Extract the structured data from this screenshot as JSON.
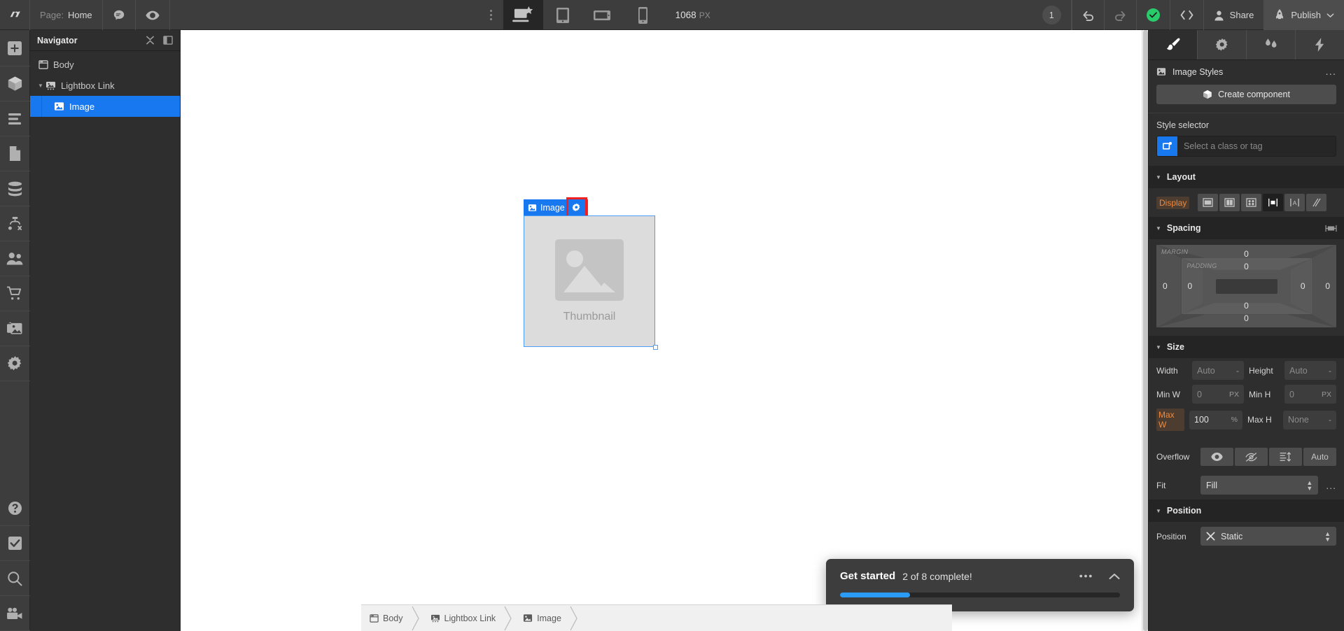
{
  "topbar": {
    "logo_icon": "webflow-logo-icon",
    "page_prefix": "Page:",
    "page_name": "Home",
    "comment_icon": "comment-icon",
    "preview_icon": "eye-icon",
    "more_icon": "vertical-dots-icon",
    "devices": [
      {
        "name": "desktop",
        "icon": "desktop-star-icon",
        "active": true
      },
      {
        "name": "tablet",
        "icon": "tablet-icon",
        "active": false
      },
      {
        "name": "tablet-landscape",
        "icon": "tablet-landscape-icon",
        "active": false
      },
      {
        "name": "mobile",
        "icon": "mobile-icon",
        "active": false
      }
    ],
    "viewport_value": "1068",
    "viewport_unit": "PX",
    "notification_count": "1",
    "undo_icon": "undo-icon",
    "redo_icon": "redo-icon",
    "status_icon": "check-circle-icon",
    "code_icon": "code-brackets-icon",
    "share_label": "Share",
    "share_icon": "person-icon",
    "publish_label": "Publish",
    "publish_icon": "rocket-icon",
    "publish_caret": "chevron-down-icon"
  },
  "lefttools": {
    "items": [
      {
        "name": "add-elements",
        "icon": "plus-icon"
      },
      {
        "name": "components",
        "icon": "cube-icon"
      },
      {
        "name": "navigator",
        "icon": "layers-icon"
      },
      {
        "name": "pages",
        "icon": "page-icon"
      },
      {
        "name": "cms",
        "icon": "database-icon"
      },
      {
        "name": "logic",
        "icon": "logic-flow-icon"
      },
      {
        "name": "users",
        "icon": "users-icon"
      },
      {
        "name": "ecommerce",
        "icon": "cart-icon"
      },
      {
        "name": "assets",
        "icon": "assets-images-icon"
      },
      {
        "name": "settings",
        "icon": "gear-icon"
      }
    ],
    "bottom_items": [
      {
        "name": "help",
        "icon": "question-circle-icon"
      },
      {
        "name": "audit",
        "icon": "checkmark-icon"
      },
      {
        "name": "search",
        "icon": "magnifier-icon"
      },
      {
        "name": "video",
        "icon": "video-camera-icon"
      }
    ]
  },
  "navigator": {
    "title": "Navigator",
    "collapse_icon": "collapse-icon",
    "dock_icon": "panel-dock-icon",
    "tree": [
      {
        "label": "Body",
        "icon": "body-icon",
        "depth": 0,
        "selected": false,
        "caret": ""
      },
      {
        "label": "Lightbox Link",
        "icon": "lightbox-icon",
        "depth": 0,
        "selected": false,
        "caret": "▼"
      },
      {
        "label": "Image",
        "icon": "image-icon",
        "depth": 1,
        "selected": true,
        "caret": ""
      }
    ]
  },
  "canvas": {
    "selected_label": "Image",
    "selected_icon": "image-icon",
    "settings_icon": "gear-icon",
    "placeholder_text": "Thumbnail",
    "placeholder_icon": "image-placeholder-icon"
  },
  "toast": {
    "title": "Get started",
    "subtitle": "2 of 8 complete!",
    "more_icon": "horizontal-dots-icon",
    "collapse_icon": "chevron-up-icon",
    "progress_percent": 25
  },
  "breadcrumb": {
    "items": [
      {
        "label": "Body",
        "icon": "body-icon"
      },
      {
        "label": "Lightbox Link",
        "icon": "lightbox-icon"
      },
      {
        "label": "Image",
        "icon": "image-icon"
      }
    ]
  },
  "rightpanel": {
    "tabs": [
      {
        "name": "style",
        "icon": "paintbrush-icon",
        "active": true
      },
      {
        "name": "settings",
        "icon": "gear-icon",
        "active": false
      },
      {
        "name": "interactions",
        "icon": "droplets-icon",
        "active": false
      },
      {
        "name": "effects",
        "icon": "lightning-icon",
        "active": false
      }
    ],
    "styles_title": "Image Styles",
    "styles_icon": "image-icon",
    "styles_more": "...",
    "create_component_label": "Create component",
    "create_component_icon": "cube-icon",
    "style_selector_label": "Style selector",
    "style_selector_placeholder": "Select a class or tag",
    "style_selector_icon": "tag-icon",
    "layout": {
      "title": "Layout",
      "display_label": "Display",
      "options": [
        {
          "name": "display-block",
          "icon": "block-icon",
          "active": false
        },
        {
          "name": "display-flex",
          "icon": "flex-icon",
          "active": false
        },
        {
          "name": "display-grid",
          "icon": "grid-icon",
          "active": false
        },
        {
          "name": "display-inline-block",
          "icon": "inline-block-icon",
          "active": true
        },
        {
          "name": "display-inline",
          "icon": "inline-icon",
          "active": false
        },
        {
          "name": "display-none",
          "icon": "none-icon",
          "active": false
        }
      ]
    },
    "spacing": {
      "title": "Spacing",
      "link_icon": "spacing-link-icon",
      "margin_label": "MARGIN",
      "padding_label": "PADDING",
      "margin_top": "0",
      "margin_right": "0",
      "margin_bottom": "0",
      "margin_left": "0",
      "padding_top": "0",
      "padding_right": "0",
      "padding_bottom": "0",
      "padding_left": "0"
    },
    "size": {
      "title": "Size",
      "fields": [
        {
          "label": "Width",
          "value": "Auto",
          "unit": "-",
          "dim": true,
          "hot": false
        },
        {
          "label": "Height",
          "value": "Auto",
          "unit": "-",
          "dim": true,
          "hot": false
        },
        {
          "label": "Min W",
          "value": "0",
          "unit": "PX",
          "dim": true,
          "hot": false
        },
        {
          "label": "Min H",
          "value": "0",
          "unit": "PX",
          "dim": true,
          "hot": false
        },
        {
          "label": "Max W",
          "value": "100",
          "unit": "%",
          "dim": false,
          "hot": true
        },
        {
          "label": "Max H",
          "value": "None",
          "unit": "-",
          "dim": true,
          "hot": false
        }
      ],
      "overflow_label": "Overflow",
      "overflow_options": [
        {
          "name": "overflow-visible",
          "icon": "eye-icon",
          "text": ""
        },
        {
          "name": "overflow-hidden",
          "icon": "eye-off-icon",
          "text": ""
        },
        {
          "name": "overflow-scroll",
          "icon": "scroll-icon",
          "text": ""
        },
        {
          "name": "overflow-auto",
          "icon": "",
          "text": "Auto"
        }
      ],
      "fit_label": "Fit",
      "fit_value": "Fill",
      "fit_more": "..."
    },
    "position": {
      "title": "Position",
      "label": "Position",
      "value": "Static",
      "clear_icon": "x-icon"
    }
  },
  "colors": {
    "accent_blue": "#1878f0",
    "highlight_red": "#f02020",
    "orange_hot": "#f08a3c",
    "green_status": "#29cc6a",
    "teal_tab": "#18d48e",
    "progress_blue": "#2b9cf5"
  }
}
